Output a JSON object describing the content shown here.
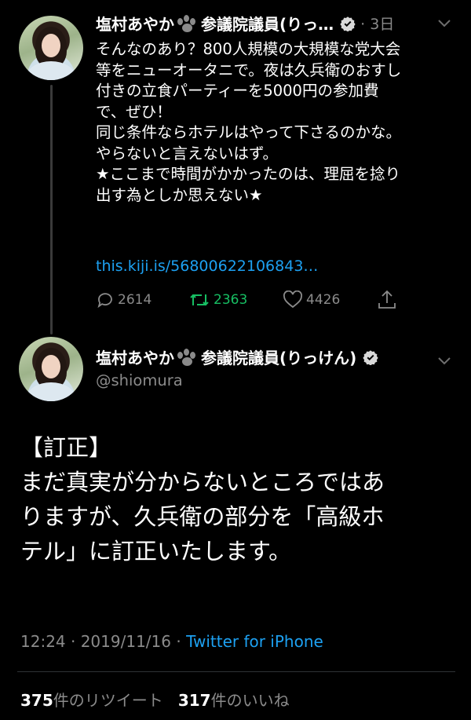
{
  "tweet1": {
    "name": "塩村あやか",
    "name_suffix": "参議院議員(りっ…",
    "time": "3日",
    "text": "そんなのあり？800人規模の大規模な党大会\n等をニューオータニで。夜は久兵衛のおすし\n付きの立食パーティーを5000円の参加費\nで、ぜひ！\n同じ条件ならホテルはやって下さるのかな。\nやらないと言えないはず。\n★ここまで時間がかかったのは、理屈を捻り\n出す為としか思えない★",
    "link": "this.kiji.is/56800622106843…",
    "replies": "2614",
    "retweets": "2363",
    "likes": "4426"
  },
  "tweet2": {
    "name": "塩村あやか",
    "name_suffix": "参議院議員(りっけん)",
    "handle": "@shiomura",
    "text": "【訂正】\nまだ真実が分からないところではあ\nりますが、久兵衛の部分を「高級ホ\nテル」に訂正いたします。",
    "time": "12:24 · 2019/11/16 · ",
    "source": "Twitter for iPhone",
    "retweet_count": "375",
    "retweet_label": "件のリツイート",
    "like_count": "317",
    "like_label": "件のいいね"
  },
  "icons": {
    "verified": "verified-badge-icon",
    "paw": "paw-emoji-icon",
    "reply": "reply-icon",
    "retweet": "retweet-icon",
    "like": "heart-icon",
    "share": "share-icon",
    "more": "chevron-down-icon"
  },
  "colors": {
    "link": "#1da1f2",
    "retweet": "#17bf63",
    "muted": "#8b8b8b"
  }
}
